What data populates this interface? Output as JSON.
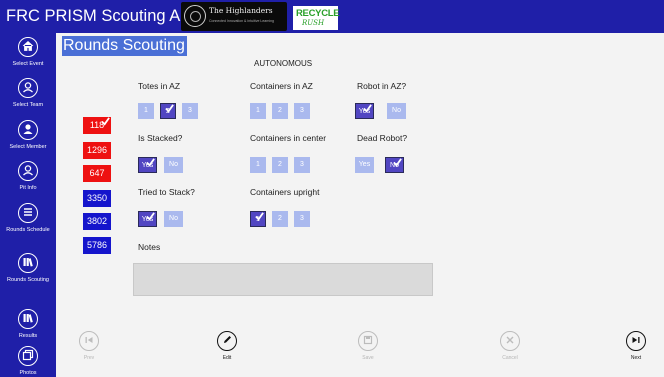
{
  "app_title": "FRC PRISM Scouting App",
  "sponsors": {
    "highlanders_title": "The Highlanders",
    "highlanders_sub": "Connected Innovation & Intuitive Learning",
    "recycle_line1": "RECYCLE",
    "recycle_line2": "RUSH"
  },
  "sidebar": {
    "items": [
      {
        "label": "Select Event",
        "icon": "home-icon"
      },
      {
        "label": "Select Team",
        "icon": "user-icon"
      },
      {
        "label": "Select Member",
        "icon": "person-icon"
      },
      {
        "label": "Pit Info",
        "icon": "user-icon"
      },
      {
        "label": "Rounds Schedule",
        "icon": "list-icon"
      },
      {
        "label": "Rounds Scouting",
        "icon": "library-icon"
      },
      {
        "label": "Results",
        "icon": "library-icon"
      },
      {
        "label": "Photos",
        "icon": "photo-icon"
      }
    ]
  },
  "page_title": "Rounds Scouting",
  "section_title": "AUTONOMOUS",
  "teams": [
    {
      "number": "118",
      "color": "red",
      "selected": true
    },
    {
      "number": "1296",
      "color": "red",
      "selected": false
    },
    {
      "number": "647",
      "color": "red",
      "selected": false
    },
    {
      "number": "3350",
      "color": "blue",
      "selected": false
    },
    {
      "number": "3802",
      "color": "blue",
      "selected": false
    },
    {
      "number": "5786",
      "color": "blue",
      "selected": false
    }
  ],
  "questions": {
    "totes_az": {
      "label": "Totes in AZ",
      "options": [
        "1",
        "2",
        "3"
      ],
      "selected": "2"
    },
    "containers_az": {
      "label": "Containers in AZ",
      "options": [
        "1",
        "2",
        "3"
      ],
      "selected": null
    },
    "robot_az": {
      "label": "Robot in AZ?",
      "options": [
        "Yes",
        "No"
      ],
      "selected": "Yes"
    },
    "is_stacked": {
      "label": "Is Stacked?",
      "options": [
        "Yes",
        "No"
      ],
      "selected": "Yes"
    },
    "containers_center": {
      "label": "Containers in center",
      "options": [
        "1",
        "2",
        "3"
      ],
      "selected": null
    },
    "dead_robot": {
      "label": "Dead Robot?",
      "options": [
        "Yes",
        "No"
      ],
      "selected": "No"
    },
    "tried_stack": {
      "label": "Tried to Stack?",
      "options": [
        "Yes",
        "No"
      ],
      "selected": "Yes"
    },
    "containers_upright": {
      "label": "Containers upright",
      "options": [
        "1",
        "2",
        "3"
      ],
      "selected": "1"
    }
  },
  "notes_label": "Notes",
  "notes_value": "",
  "actions": {
    "prev": "Prev",
    "edit": "Edit",
    "save": "Save",
    "cancel": "Cancel",
    "next": "Next"
  },
  "colors": {
    "brand": "#1f1fa8",
    "option": "#aab9ee",
    "option_selected": "#5146c2",
    "red_alliance": "#ee1111",
    "blue_alliance": "#1515cc"
  }
}
